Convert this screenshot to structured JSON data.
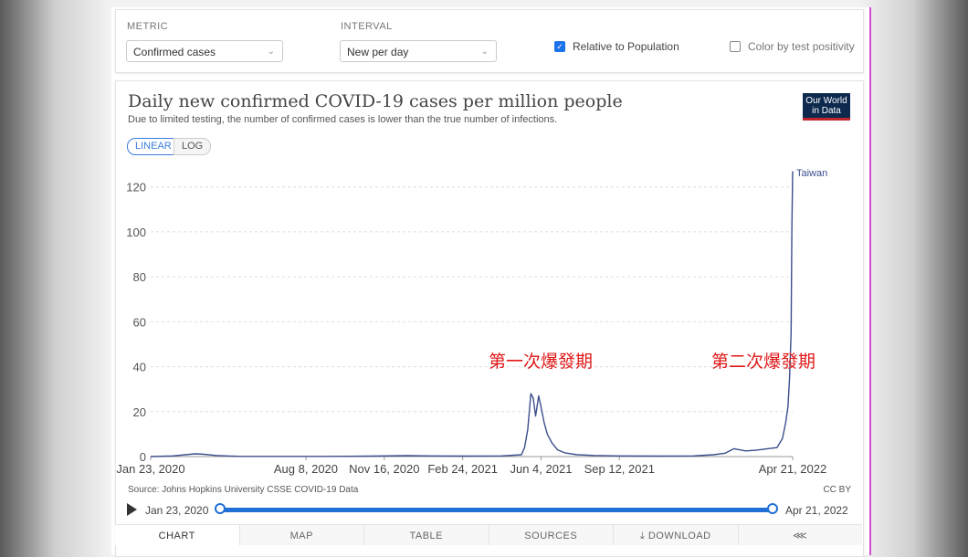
{
  "controls": {
    "metric_label": "METRIC",
    "metric_value": "Confirmed cases",
    "interval_label": "INTERVAL",
    "interval_value": "New per day",
    "relative_label": "Relative to Population",
    "relative_checked": true,
    "positivity_label": "Color by test positivity",
    "positivity_checked": false
  },
  "logo": {
    "line1": "Our World",
    "line2": "in Data"
  },
  "scale": {
    "linear": "LINEAR",
    "log": "LOG"
  },
  "footer": {
    "source": "Source: Johns Hopkins University CSSE COVID-19 Data",
    "license": "CC BY"
  },
  "timeline": {
    "start": "Jan 23, 2020",
    "end": "Apr 21, 2022"
  },
  "tabs": [
    "CHART",
    "MAP",
    "TABLE",
    "SOURCES",
    "DOWNLOAD"
  ],
  "annotations": [
    "第一次爆發期",
    "第二次爆發期"
  ],
  "colors": {
    "line": "#3c4e8c",
    "accent": "#1f6fd6",
    "annotation": "#e01818"
  },
  "chart_data": {
    "type": "line",
    "title": "Daily new confirmed COVID-19 cases per million people",
    "subtitle": "Due to limited testing, the number of confirmed cases is lower than the true number of infections.",
    "xlabel": "",
    "ylabel": "",
    "ylim": [
      0,
      128
    ],
    "yticks": [
      0,
      20,
      40,
      60,
      80,
      100,
      120
    ],
    "xticks": [
      "Jan 23, 2020",
      "Aug 8, 2020",
      "Nov 16, 2020",
      "Feb 24, 2021",
      "Jun 4, 2021",
      "Sep 12, 2021",
      "Apr 21, 2022"
    ],
    "grid": "horizontal",
    "series": [
      {
        "name": "Taiwan",
        "x": [
          "2020-01-23",
          "2020-02-20",
          "2020-03-20",
          "2020-03-31",
          "2020-04-15",
          "2020-05-15",
          "2020-07-01",
          "2020-09-01",
          "2020-11-01",
          "2020-12-15",
          "2021-01-15",
          "2021-03-01",
          "2021-04-15",
          "2021-05-10",
          "2021-05-14",
          "2021-05-18",
          "2021-05-22",
          "2021-05-25",
          "2021-05-28",
          "2021-06-01",
          "2021-06-04",
          "2021-06-08",
          "2021-06-12",
          "2021-06-18",
          "2021-06-25",
          "2021-07-05",
          "2021-07-20",
          "2021-08-10",
          "2021-09-12",
          "2021-11-01",
          "2021-12-15",
          "2022-01-10",
          "2022-01-25",
          "2022-02-05",
          "2022-02-20",
          "2022-03-05",
          "2022-03-20",
          "2022-04-01",
          "2022-04-08",
          "2022-04-12",
          "2022-04-15",
          "2022-04-17",
          "2022-04-19",
          "2022-04-20",
          "2022-04-21"
        ],
        "y": [
          0,
          0.3,
          1.2,
          1.0,
          0.5,
          0.1,
          0.1,
          0.1,
          0.2,
          0.4,
          0.3,
          0.2,
          0.3,
          0.8,
          4,
          12,
          28,
          26,
          18,
          27,
          22,
          15,
          10,
          6,
          3,
          1.6,
          0.8,
          0.5,
          0.3,
          0.2,
          0.3,
          0.8,
          1.5,
          3.5,
          2.5,
          2.8,
          3.5,
          4,
          8,
          15,
          22,
          35,
          55,
          100,
          127
        ]
      }
    ]
  }
}
